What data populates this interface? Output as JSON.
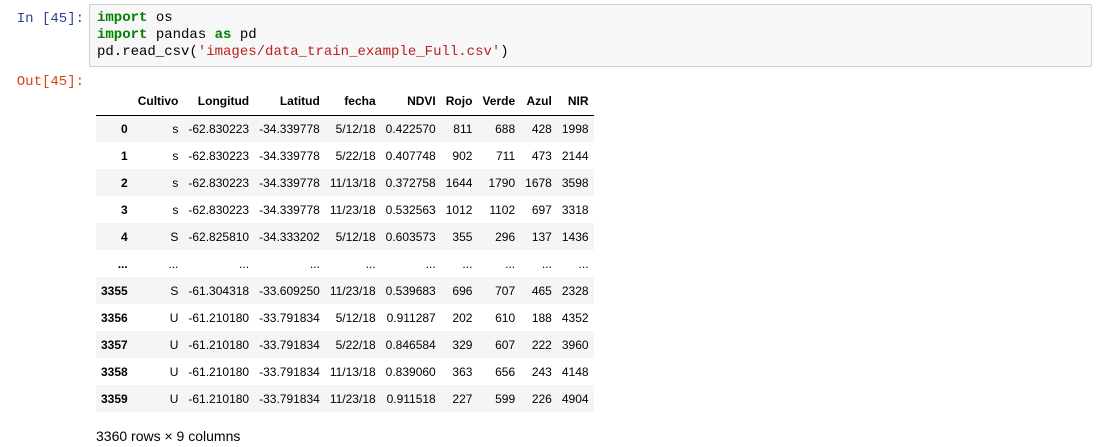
{
  "input_prompt": "In [45]:",
  "output_prompt": "Out[45]:",
  "code": {
    "line1": {
      "kw": "import",
      "rest": " os"
    },
    "line2": {
      "kw1": "import",
      "mid": " pandas ",
      "kw2": "as",
      "rest": " pd"
    },
    "line3": {
      "pre": "pd.read_csv(",
      "str": "'images/data_train_example_Full.csv'",
      "post": ")"
    }
  },
  "table": {
    "columns": [
      "",
      "Cultivo",
      "Longitud",
      "Latitud",
      "fecha",
      "NDVI",
      "Rojo",
      "Verde",
      "Azul",
      "NIR"
    ],
    "rows": [
      [
        "0",
        "s",
        "-62.830223",
        "-34.339778",
        "5/12/18",
        "0.422570",
        "811",
        "688",
        "428",
        "1998"
      ],
      [
        "1",
        "s",
        "-62.830223",
        "-34.339778",
        "5/22/18",
        "0.407748",
        "902",
        "711",
        "473",
        "2144"
      ],
      [
        "2",
        "s",
        "-62.830223",
        "-34.339778",
        "11/13/18",
        "0.372758",
        "1644",
        "1790",
        "1678",
        "3598"
      ],
      [
        "3",
        "s",
        "-62.830223",
        "-34.339778",
        "11/23/18",
        "0.532563",
        "1012",
        "1102",
        "697",
        "3318"
      ],
      [
        "4",
        "S",
        "-62.825810",
        "-34.333202",
        "5/12/18",
        "0.603573",
        "355",
        "296",
        "137",
        "1436"
      ],
      [
        "...",
        "...",
        "...",
        "...",
        "...",
        "...",
        "...",
        "...",
        "...",
        "..."
      ],
      [
        "3355",
        "S",
        "-61.304318",
        "-33.609250",
        "11/23/18",
        "0.539683",
        "696",
        "707",
        "465",
        "2328"
      ],
      [
        "3356",
        "U",
        "-61.210180",
        "-33.791834",
        "5/12/18",
        "0.911287",
        "202",
        "610",
        "188",
        "4352"
      ],
      [
        "3357",
        "U",
        "-61.210180",
        "-33.791834",
        "5/22/18",
        "0.846584",
        "329",
        "607",
        "222",
        "3960"
      ],
      [
        "3358",
        "U",
        "-61.210180",
        "-33.791834",
        "11/13/18",
        "0.839060",
        "363",
        "656",
        "243",
        "4148"
      ],
      [
        "3359",
        "U",
        "-61.210180",
        "-33.791834",
        "11/23/18",
        "0.911518",
        "227",
        "599",
        "226",
        "4904"
      ]
    ]
  },
  "shape_text": "3360 rows × 9 columns"
}
